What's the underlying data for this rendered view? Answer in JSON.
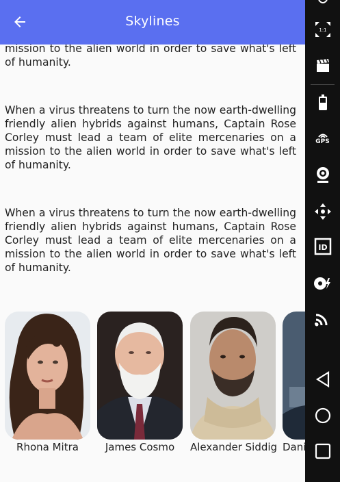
{
  "appbar": {
    "title": "Skylines"
  },
  "paragraphs": [
    "When a virus threatens to turn the now earth-dwelling friendly alien hybrids against humans, Captain Rose Corley must lead a team of elite mercenaries on a mission to the alien world in order to save what's left of humanity.",
    "When a virus threatens to turn the now earth-dwelling friendly alien hybrids against humans, Captain Rose Corley must lead a team of elite mercenaries on a mission to the alien world in order to save what's left of humanity.",
    "When a virus threatens to turn the now earth-dwelling friendly alien hybrids against humans, Captain Rose Corley must lead a team of elite mercenaries on a mission to the alien world in order to save what's left of humanity."
  ],
  "cast": [
    {
      "name": "Rhona Mitra"
    },
    {
      "name": "James Cosmo"
    },
    {
      "name": "Alexander Siddig"
    },
    {
      "name": "Dani"
    }
  ],
  "side_toolbar": {
    "gps_label": "GPS",
    "id_label": "ID",
    "scale_label": "1:1"
  },
  "colors": {
    "appbar": "#5a6ff0",
    "background": "#fafafa",
    "side_toolbar": "#111111"
  }
}
